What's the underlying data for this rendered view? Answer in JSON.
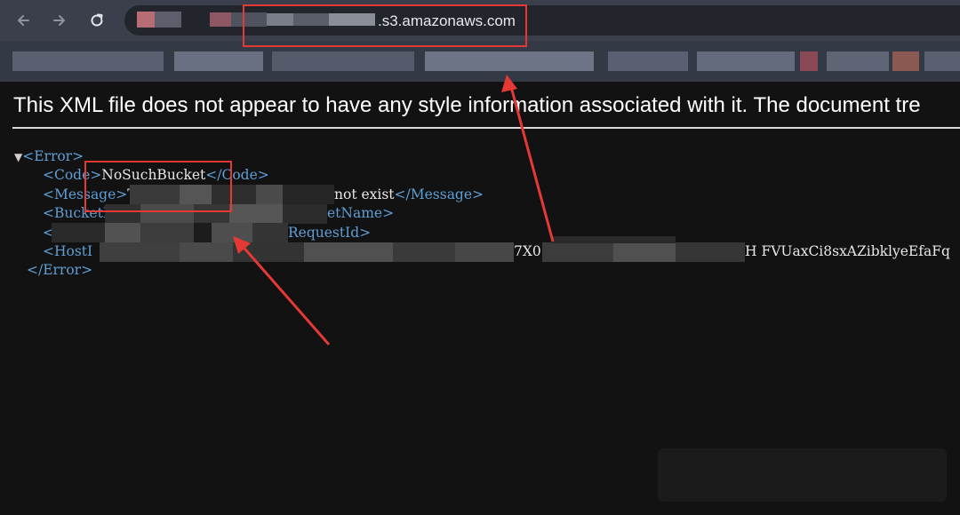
{
  "browser": {
    "url_visible_suffix": ".s3.amazonaws.com"
  },
  "notice": {
    "text": "This XML file does not appear to have any style information associated with it. The document tre"
  },
  "xml": {
    "toggle": "▼",
    "error_open": "<Error>",
    "error_close": "</Error>",
    "code_open": "<Code>",
    "code_value": "NoSuchBucket",
    "code_close": "</Code>",
    "message_open": "<Message>",
    "message_first_char": "T",
    "message_visible_tail": "not exist",
    "message_close": "</Message>",
    "bucket_open_fragment": "<BucketN",
    "bucket_close_fragment": "etName>",
    "request_open_fragment": "<",
    "request_close_fragment": "RequestId>",
    "host_open_fragment": "<HostI",
    "host_mid_fragment": "7X0",
    "host_tail_fragment": "H FVUaxCi8sxAZibklyeEfaFq"
  },
  "annotation_color": "#e53935"
}
